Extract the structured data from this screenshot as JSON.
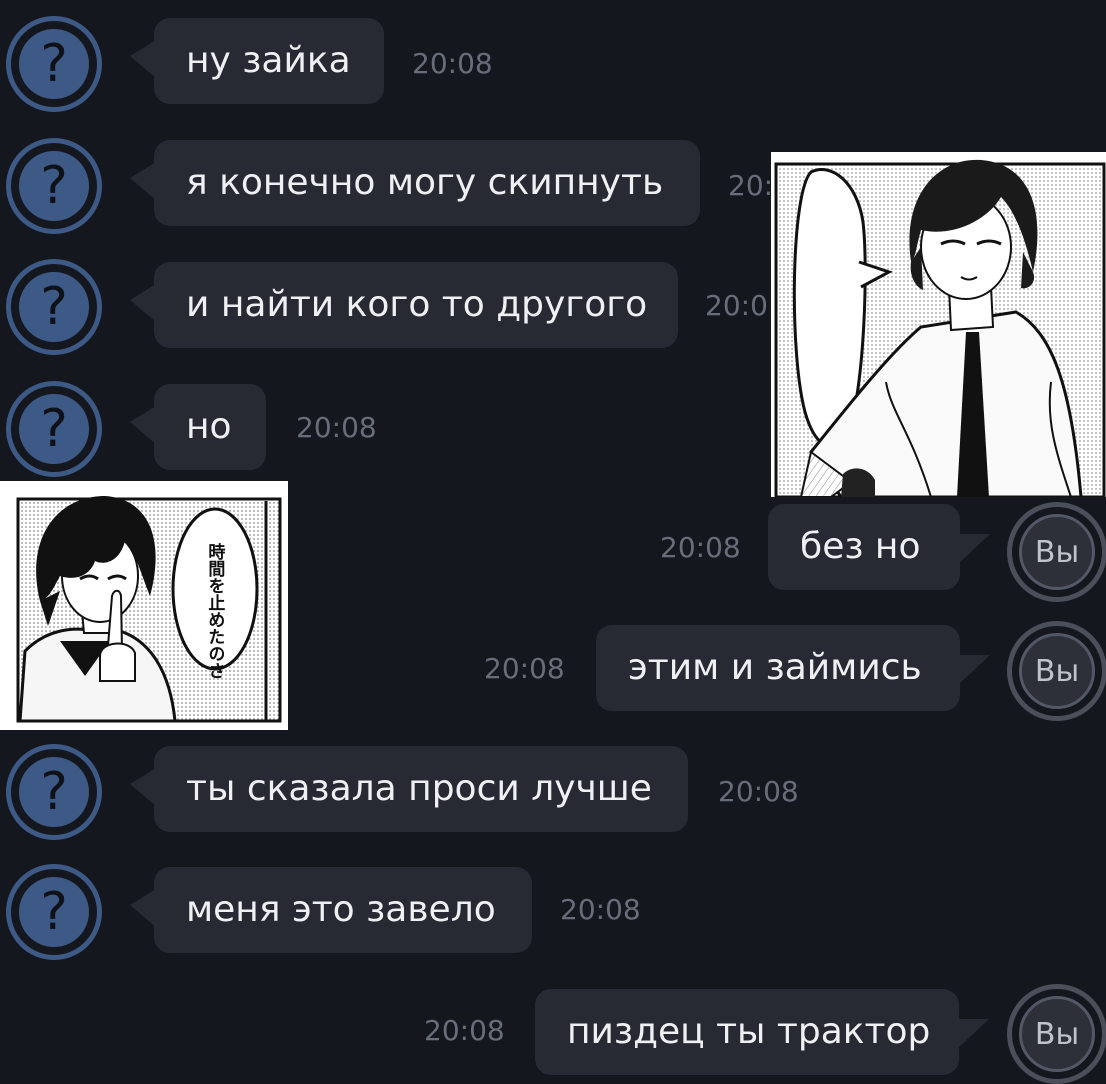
{
  "colors": {
    "background": "#15171f",
    "bubble": "#272a33",
    "other_avatar": "#3d5a86",
    "my_avatar_ring": "#4a4f5a",
    "timestamp": "#676d79",
    "message_text": "#eef0f3"
  },
  "icons": {
    "other_avatar": "question-mark-icon",
    "my_avatar": "label-avatar"
  },
  "other_avatar_glyph": "?",
  "my_avatar_label": "Вы",
  "messages": [
    {
      "side": "in",
      "text": "ну зайка",
      "time": "20:08"
    },
    {
      "side": "in",
      "text": "я конечно могу скипнуть",
      "time": "20:"
    },
    {
      "side": "in",
      "text": "и найти кого то другого",
      "time": "20:0"
    },
    {
      "side": "in",
      "text": "но",
      "time": "20:08"
    },
    {
      "side": "out",
      "text": "без но",
      "time": "20:08"
    },
    {
      "side": "out",
      "text": "этим и займись",
      "time": "20:08"
    },
    {
      "side": "in",
      "text": "ты сказала проси лучше",
      "time": "20:08"
    },
    {
      "side": "in",
      "text": "меня это завело",
      "time": "20:08"
    },
    {
      "side": "out",
      "text": "пиздец ты трактор",
      "time": "20:08"
    }
  ],
  "manga_panel_left": {
    "speech_bubble_text": "時間を止めたのさ",
    "furigana_1": "じかん",
    "furigana_2": "と"
  },
  "manga_panel_right": {
    "speech_bubble_text": ""
  }
}
